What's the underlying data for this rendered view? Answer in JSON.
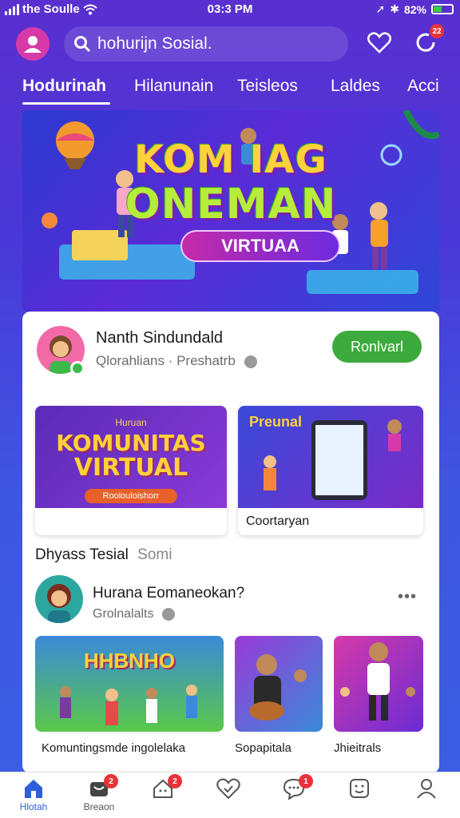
{
  "status": {
    "carrier": "the Soulle",
    "time": "03:3 PM",
    "battery": "82%"
  },
  "search": {
    "placeholder": "hohurijn Sosial."
  },
  "header": {
    "notif_badge": "22"
  },
  "tabs": [
    {
      "label": "Hodurinah",
      "active": true
    },
    {
      "label": "Hilanunain"
    },
    {
      "label": "Teisleos"
    },
    {
      "label": "Laldes"
    },
    {
      "label": "Acci"
    }
  ],
  "hero": {
    "line1": "KOM IAG",
    "line2": "ONEMAN",
    "pill": "VIRTUAA"
  },
  "profile": {
    "name": "Nanth Sindundald",
    "subtitle": "Qlorahlians · Preshatrb",
    "follow_label": "Ronlvarl"
  },
  "featured": [
    {
      "title_small": "Huruan",
      "title_big1": "KOMUNITAS",
      "title_big2": "VIRTUAL",
      "button": "Roolouloishorr",
      "caption": ""
    },
    {
      "title": "Preunal",
      "caption": "Coortaryan"
    }
  ],
  "section": {
    "title": "Dhyass Tesial",
    "suffix": "Somi"
  },
  "post": {
    "name": "Hurana Eomaneokan?",
    "subtitle": "Grolnalalts",
    "more": "•••"
  },
  "thumbnails": [
    {
      "caption": "Komuntingsmde ingolelaka",
      "title": "HHBNHO"
    },
    {
      "caption": "Sopapitala"
    },
    {
      "caption": "Jhieitrals"
    }
  ],
  "nav": [
    {
      "label": "Hlotah",
      "icon": "home-icon",
      "active": true
    },
    {
      "label": "Breaon",
      "icon": "store-icon",
      "badge": "2"
    },
    {
      "label": "",
      "icon": "house-notify-icon",
      "badge": "2"
    },
    {
      "label": "",
      "icon": "heart-check-icon"
    },
    {
      "label": "",
      "icon": "chat-icon",
      "badge": "1"
    },
    {
      "label": "",
      "icon": "smile-icon"
    },
    {
      "label": "",
      "icon": "profile-icon"
    }
  ],
  "colors": {
    "accent": "#2d5fd8",
    "follow": "#3daa3d",
    "badge": "#e8323a",
    "bg_top": "#5a2fd0",
    "bg_bottom": "#3a5fe4"
  }
}
